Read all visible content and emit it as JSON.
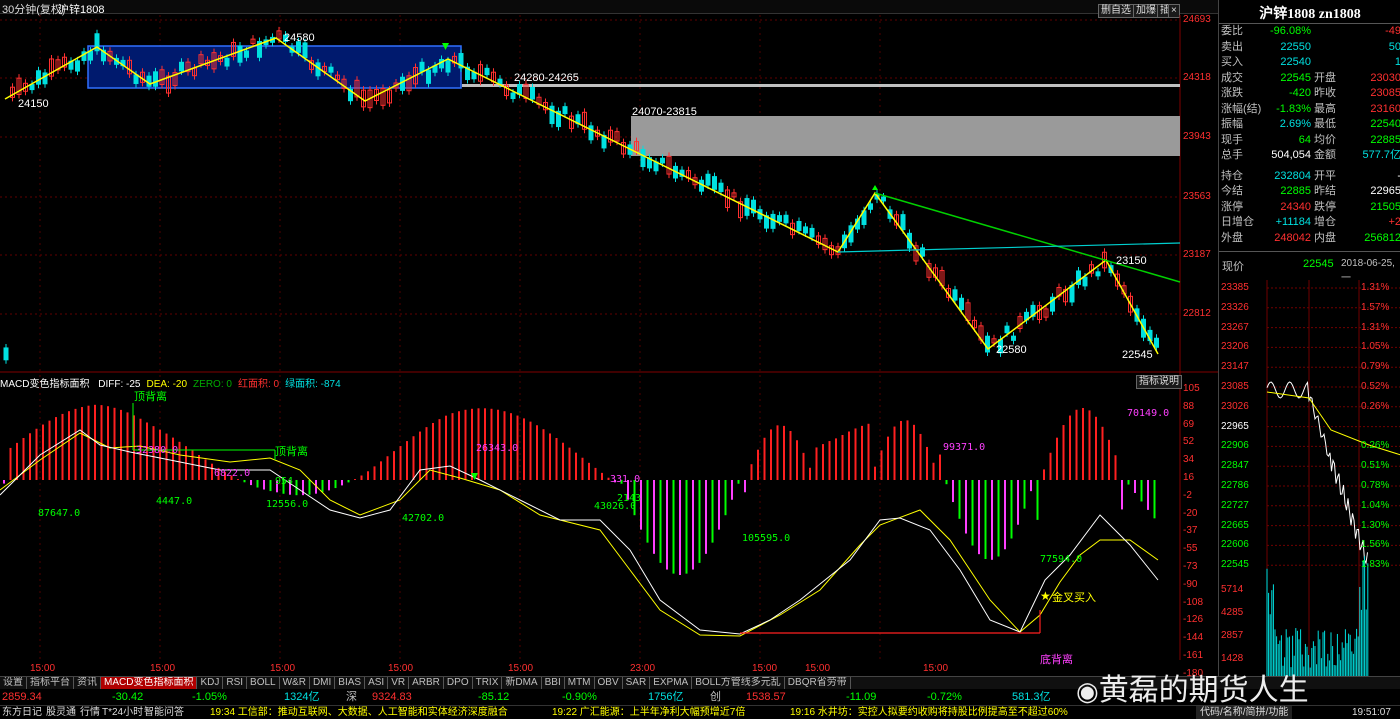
{
  "header": {
    "period": "30分钟(复权)",
    "symbol": "沪锌1808",
    "buttons": [
      "删自选",
      "加爆",
      "插"
    ]
  },
  "main_chart": {
    "price_axis": [
      "24693",
      "24318",
      "23943",
      "23563",
      "23187",
      "22812"
    ],
    "annotations": {
      "high_1": "24150",
      "peak": "24580",
      "zone_1": "24280-24265",
      "zone_2": "24070-23815",
      "swing_high": "23150",
      "low_1": "22580",
      "low_2": "22545"
    }
  },
  "macd": {
    "title": "MACD变色指标面积",
    "legend": [
      {
        "label": "DIFF: -25",
        "color": "#ffffff"
      },
      {
        "label": "DEA: -20",
        "color": "#ffff00"
      },
      {
        "label": "ZERO: 0",
        "color": "#00aa00"
      },
      {
        "label": "红面积: 0",
        "color": "#ff3030"
      },
      {
        "label": "绿面积: -874",
        "color": "#00e0e0"
      }
    ],
    "explain_button": "指标说明",
    "axis": [
      "105",
      "88",
      "69",
      "52",
      "34",
      "16",
      "-2",
      "-20",
      "-37",
      "-55",
      "-73",
      "-90",
      "-108",
      "-126",
      "-144",
      "-161",
      "-180",
      "-197"
    ],
    "area_labels": [
      "87647.0",
      "32380.0",
      "4447.0",
      "6822.0",
      "954",
      "12556.0",
      "26343.0",
      "42702.0",
      "331.0",
      "2143",
      "43026.0",
      "105595.0",
      "99371.0",
      "77594.0",
      "70149.0"
    ],
    "notes": {
      "top_div_1": "顶背离",
      "top_div_2": "顶背离",
      "bottom_div": "底背离",
      "golden_cross": "金叉买入"
    }
  },
  "time_axis": [
    "15:00",
    "15:00",
    "15:00",
    "15:00",
    "15:00",
    "23:00",
    "15:00",
    "15:00",
    "15:00"
  ],
  "quote": {
    "title": "沪锌1808 zn1808",
    "rows": [
      {
        "l1": "委比",
        "v1": "-96.08%",
        "l2": "",
        "v2": "-49"
      },
      {
        "l1": "卖出",
        "v1": "22550",
        "l2": "",
        "v2": "50"
      },
      {
        "l1": "买入",
        "v1": "22540",
        "l2": "",
        "v2": "1"
      },
      {
        "l1": "成交",
        "v1": "22545",
        "l2": "开盘",
        "v2": "23030"
      },
      {
        "l1": "涨跌",
        "v1": "-420",
        "l2": "昨收",
        "v2": "23085"
      },
      {
        "l1": "涨幅(结)",
        "v1": "-1.83%",
        "l2": "最高",
        "v2": "23160"
      },
      {
        "l1": "振幅",
        "v1": "2.69%",
        "l2": "最低",
        "v2": "22540"
      },
      {
        "l1": "现手",
        "v1": "64",
        "l2": "均价",
        "v2": "22885"
      },
      {
        "l1": "总手",
        "v1": "504,054",
        "l2": "金额",
        "v2": "577.7亿"
      },
      {
        "l1": "持仓",
        "v1": "232804",
        "l2": "开平",
        "v2": "-"
      },
      {
        "l1": "今结",
        "v1": "22885",
        "l2": "昨结",
        "v2": "22965"
      },
      {
        "l1": "涨停",
        "v1": "24340",
        "l2": "跌停",
        "v2": "21505"
      },
      {
        "l1": "日增仓",
        "v1": "+11184",
        "l2": "增仓",
        "v2": "+2"
      },
      {
        "l1": "外盘",
        "v1": "248042",
        "l2": "内盘",
        "v2": "256812"
      }
    ],
    "now_label": "现价",
    "now_value": "22545",
    "date": "2018-06-25,一"
  },
  "mini_chart": {
    "prices": [
      "23385",
      "23326",
      "23267",
      "23206",
      "23147",
      "23085",
      "23026",
      "22965",
      "22906",
      "22847",
      "22786",
      "22727",
      "22665",
      "22606",
      "22545"
    ],
    "pcts": [
      "1.31%",
      "1.57%",
      "1.31%",
      "1.05%",
      "0.79%",
      "0.52%",
      "0.26%",
      "",
      "0.26%",
      "0.51%",
      "0.78%",
      "1.04%",
      "1.30%",
      "1.56%",
      "1.83%"
    ],
    "volumes": [
      "5714",
      "4285",
      "2857",
      "1428"
    ]
  },
  "tabs": [
    "设置",
    "指标平台",
    "资讯",
    "MACD变色指标面积",
    "KDJ",
    "RSI",
    "BOLL",
    "W&R",
    "DMI",
    "BIAS",
    "ASI",
    "VR",
    "ARBR",
    "DPO",
    "TRIX",
    "新DMA",
    "BBI",
    "MTM",
    "OBV",
    "SAR",
    "EXPMA",
    "BOLL方管线多元乱",
    "DBQR省劳带"
  ],
  "index_bar": {
    "v1": "2859.34",
    "c1": "-30.42",
    "p1": "-1.05%",
    "a1": "1324亿",
    "n2": "深",
    "v2": "9324.83",
    "c2": "-85.12",
    "p2": "-0.90%",
    "a2": "1756亿",
    "n3": "创",
    "v3": "1538.57",
    "c3": "-11.09",
    "p3": "-0.72%",
    "a3": "581.3亿"
  },
  "news": {
    "items": [
      "东方日记",
      "股灵通",
      "行情",
      "T*24小时",
      "智能问答"
    ],
    "h1": "19:34 工信部：推动互联网、大数据、人工智能和实体经济深度融合",
    "h2": "19:22 广汇能源：上半年净利大幅预增近7倍",
    "h3": "19:16 水井坊：实控人拟要约收购将持股比例提高至不超过60%",
    "right": "代码/名称/简拼/功能",
    "time": "19:51:07"
  },
  "watermark": "黄磊的期货人生",
  "colors": {
    "up": "#ff3030",
    "down": "#00e0e0",
    "grid": "#800000",
    "line": "#ffff00"
  }
}
